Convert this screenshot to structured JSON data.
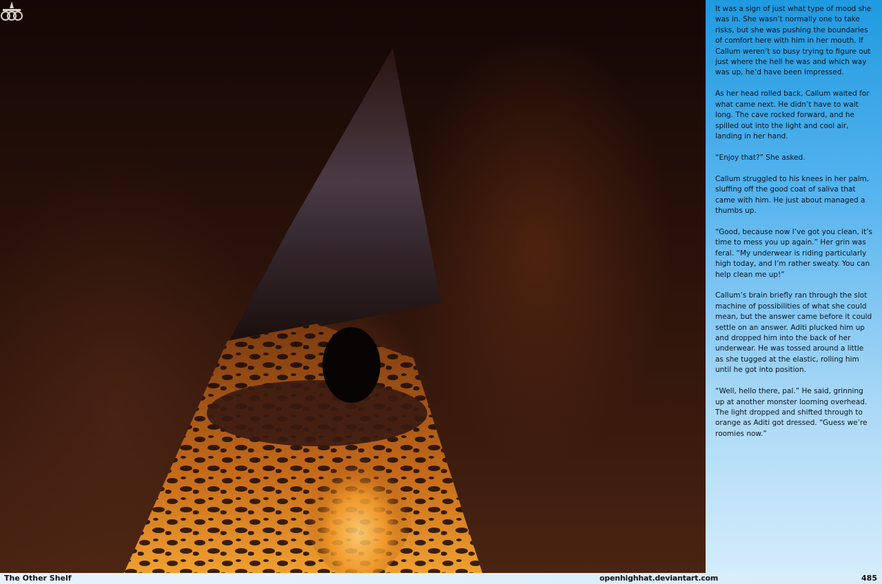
{
  "panel": {
    "paragraphs": [
      "It was a sign of just what type of mood she was in. She wasn’t normally one to take risks, but she was pushing the boundaries of comfort here with him in her mouth. If Callum weren’t so busy trying to figure out just where the hell he was and which way was up, he’d have been impressed.",
      "As her head rolled back, Callum waited for what came next. He didn’t have to wait long. The cave rocked forward, and he spilled out into the light and cool air, landing in her hand.",
      "“Enjoy that?” She asked.",
      "Callum struggled to his knees in her palm, sluffing off the good coat of saliva that came with him. He just about managed a thumbs up.",
      "“Good, because now I’ve got you clean, it’s time to mess you up again.” Her grin was feral. “My underwear is riding particularly high today, and I’m rather sweaty. You can help clean me up!”",
      "Callum’s brain briefly ran through the slot machine of possibilities of what she could mean, but the answer came before it could settle on an answer. Aditi plucked him up and dropped him into the back of her underwear. He was tossed around a little as she tugged at the elastic, rolling him until he got into position.",
      "“Well, hello there, pal.” He said, grinning up at another monster looming overhead. The light dropped and shifted through to orange as Aditi got dressed. “Guess we’re roomies now.”"
    ]
  },
  "footer": {
    "title": "The Other Shelf",
    "url": "openhighhat.deviantart.com",
    "page_number": "485"
  },
  "logo": {
    "text": "OHH"
  }
}
